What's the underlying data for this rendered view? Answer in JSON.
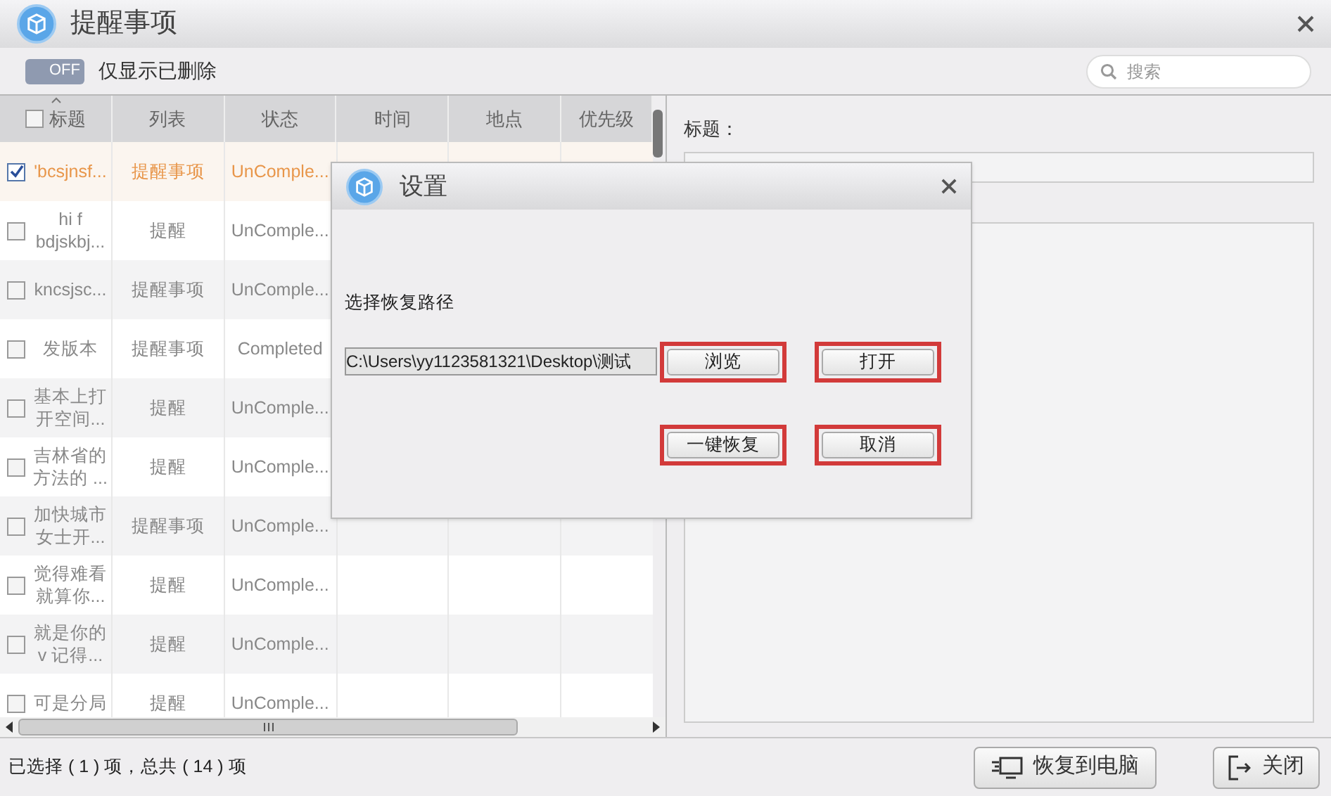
{
  "window": {
    "title": "提醒事项"
  },
  "toolbar": {
    "toggle": {
      "on": false,
      "text": "OFF"
    },
    "toggle_label": "仅显示已删除",
    "search": {
      "placeholder": "搜索"
    }
  },
  "table": {
    "select_all": {
      "checked": false
    },
    "columns": [
      "标题",
      "列表",
      "状态",
      "时间",
      "地点",
      "优先级"
    ],
    "rows": [
      {
        "title": "'bcsjnsf...",
        "list": "提醒事项",
        "status": "UnComple...",
        "checked": true,
        "selected": true
      },
      {
        "title": "hi f\nbdjskbj...",
        "list": "提醒",
        "status": "UnComple...",
        "checked": false,
        "selected": false
      },
      {
        "title": "kncsjsc...",
        "list": "提醒事项",
        "status": "UnComple...",
        "checked": false,
        "selected": false
      },
      {
        "title": "发版本",
        "list": "提醒事项",
        "status": "Completed",
        "checked": false,
        "selected": false
      },
      {
        "title": "基本上打开空间...",
        "list": "提醒",
        "status": "UnComple...",
        "checked": false,
        "selected": false
      },
      {
        "title": "吉林省的方法的 ...",
        "list": "提醒",
        "status": "UnComple...",
        "checked": false,
        "selected": false
      },
      {
        "title": "加快城市女士开...",
        "list": "提醒事项",
        "status": "UnComple...",
        "checked": false,
        "selected": false
      },
      {
        "title": "觉得难看就算你...",
        "list": "提醒",
        "status": "UnComple...",
        "checked": false,
        "selected": false
      },
      {
        "title": "就是你的\nv 记得...",
        "list": "提醒",
        "status": "UnComple...",
        "checked": false,
        "selected": false
      },
      {
        "title": "可是分局",
        "list": "提醒",
        "status": "UnComple...",
        "checked": false,
        "selected": false
      }
    ]
  },
  "detail": {
    "title_label": "标题："
  },
  "status_bar": {
    "text": "已选择 ( 1 ) 项，总共 ( 14 ) 项",
    "buttons": [
      {
        "kind": "restore",
        "label": "恢复到电脑"
      },
      {
        "kind": "close",
        "label": "关闭"
      }
    ]
  },
  "dialog": {
    "title": "设置",
    "path_label": "选择恢复路径",
    "path": "C:\\Users\\yy1123581321\\Desktop\\测试",
    "buttons": [
      "浏览",
      "打开",
      "一键恢复",
      "取消"
    ]
  }
}
